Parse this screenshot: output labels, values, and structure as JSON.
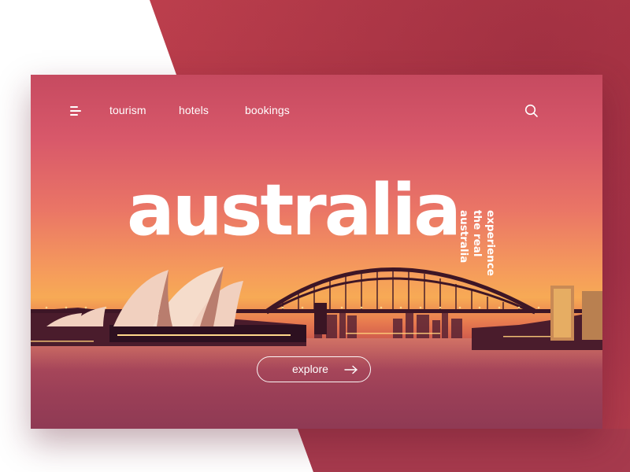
{
  "nav": {
    "items": [
      {
        "label": "tourism"
      },
      {
        "label": "hotels"
      },
      {
        "label": "bookings"
      }
    ],
    "menu_icon": "hamburger-icon",
    "search_icon": "search-icon"
  },
  "hero": {
    "title": "australia",
    "tagline": [
      "experience",
      "the real",
      "australia"
    ],
    "cta_label": "explore",
    "cta_icon": "arrow-right-icon"
  },
  "colors": {
    "accent_red": "#b73a4a",
    "sky_orange": "#f59a5c",
    "text": "#ffffff"
  }
}
